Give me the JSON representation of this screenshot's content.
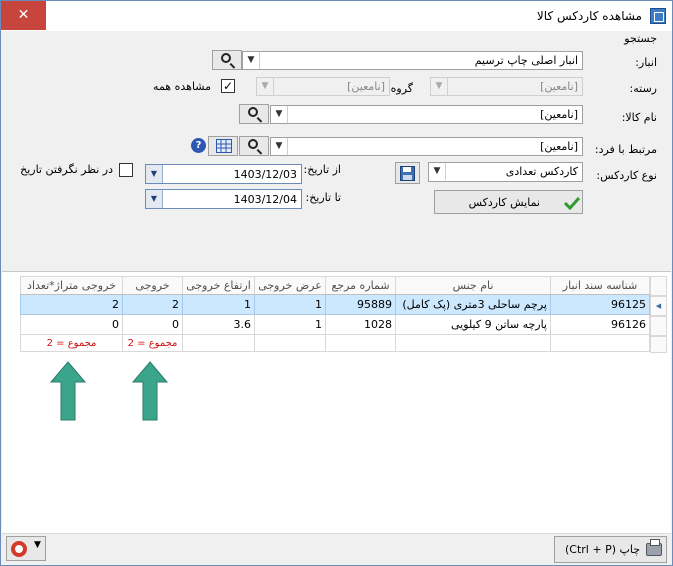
{
  "window": {
    "title": "مشاهده کاردکس کالا",
    "close_glyph": "✕"
  },
  "search": {
    "group_title": "جستجو",
    "warehouse_label": "انبار:",
    "warehouse_value": "انبار اصلی چاپ ترسیم",
    "category_label": "رسته:",
    "category_value": "[نامعین]",
    "group_label": "گروه:",
    "group_value": "[نامعین]",
    "show_all_label": "مشاهده همه",
    "show_all_checked": "✓",
    "item_label": "نام کالا:",
    "item_value": "[نامعین]",
    "person_label": "مرتبط با فرد:",
    "person_value": "[نامعین]",
    "kardex_type_label": "نوع کاردکس:",
    "kardex_type_value": "کاردکس تعدادی",
    "from_date_label": "از تاریخ:",
    "from_date_value": "1403/12/03",
    "to_date_label": "تا تاریخ:",
    "to_date_value": "1403/12/04",
    "ignore_date_label": "در نظر نگرفتن تاریخ",
    "show_kardex_label": "نمایش کاردکس",
    "help_glyph": "?"
  },
  "grid": {
    "columns": [
      "شناسه سند انبار",
      "نام جنس",
      "شماره مرجع",
      "عرض خروجی",
      "ارتفاع خروجی",
      "خروجی",
      "خروجی متراژ*تعداد"
    ],
    "rows": [
      [
        "96125",
        "پرچم ساحلی 3متری (پک کامل)",
        "95889",
        "1",
        "1",
        "2",
        "2"
      ],
      [
        "96126",
        "پارچه ساتن 9 کیلویی",
        "1028",
        "1",
        "3.6",
        "0",
        "0"
      ]
    ],
    "summary_output": "مجموع = 2",
    "summary_area": "مجموع = 2"
  },
  "bottom": {
    "print_label": "چاپ (Ctrl + P)"
  },
  "colors": {
    "selected_row": "#cce8ff",
    "arrow": "#3aa58a",
    "summary_text": "#d01010"
  }
}
